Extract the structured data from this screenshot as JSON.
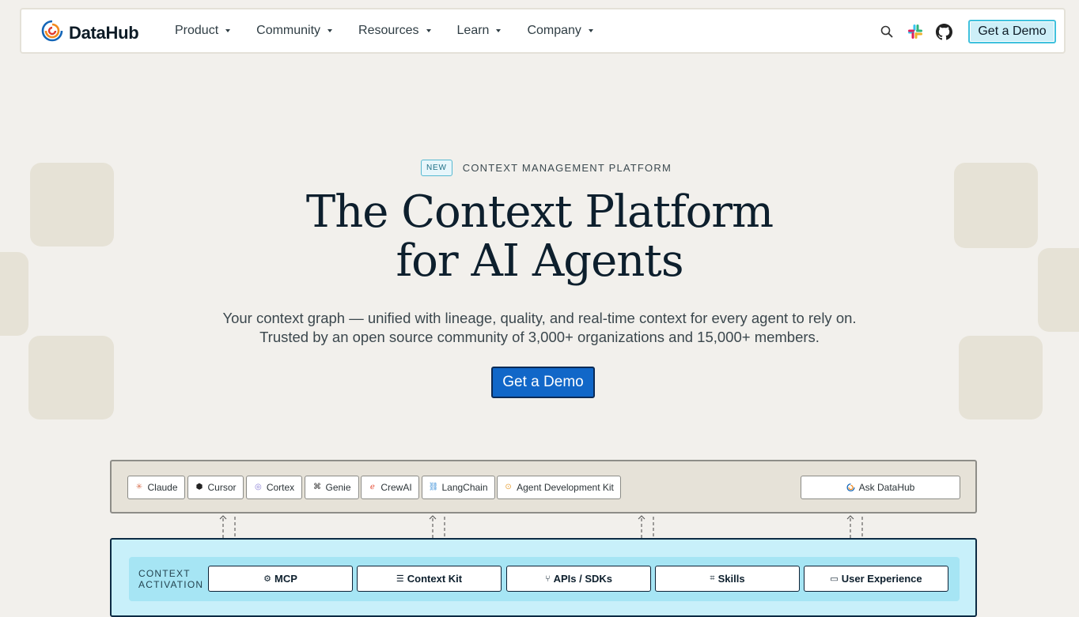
{
  "nav": {
    "logo_text": "DataHub",
    "menu": [
      {
        "label": "Product"
      },
      {
        "label": "Community"
      },
      {
        "label": "Resources"
      },
      {
        "label": "Learn"
      },
      {
        "label": "Company"
      }
    ],
    "icons": [
      "search-icon",
      "slack-icon",
      "github-icon"
    ],
    "cta_label": "Get a Demo"
  },
  "hero": {
    "badge": "NEW",
    "eyebrow": "CONTEXT MANAGEMENT PLATFORM",
    "title_line1": "The Context Platform",
    "title_line2": "for AI Agents",
    "subtitle_line1": "Your context graph — unified with lineage, quality, and real-time context for every agent to rely on.",
    "subtitle_line2": "Trusted by an open source community of 3,000+ organizations and 15,000+ members.",
    "cta_label": "Get a Demo"
  },
  "diagram": {
    "agents": [
      {
        "label": "Claude",
        "icon": "claude-icon",
        "color": "#d97757"
      },
      {
        "label": "Cursor",
        "icon": "cursor-icon",
        "color": "#222222"
      },
      {
        "label": "Cortex",
        "icon": "cortex-icon",
        "color": "#8a7fd6"
      },
      {
        "label": "Genie",
        "icon": "genie-icon",
        "color": "#333333"
      },
      {
        "label": "CrewAI",
        "icon": "crewai-icon",
        "color": "#e5533d"
      },
      {
        "label": "LangChain",
        "icon": "langchain-icon",
        "color": "#3a8fd8"
      },
      {
        "label": "Agent Development Kit",
        "icon": "adk-icon",
        "color": "#e8a23a"
      }
    ],
    "ask_label": "Ask DataHub",
    "activation_label_line1": "CONTEXT",
    "activation_label_line2": "ACTIVATION",
    "activation_items": [
      {
        "label": "MCP",
        "icon": "mcp-icon"
      },
      {
        "label": "Context Kit",
        "icon": "context-kit-icon"
      },
      {
        "label": "APIs / SDKs",
        "icon": "api-icon"
      },
      {
        "label": "Skills",
        "icon": "skills-icon"
      },
      {
        "label": "User Experience",
        "icon": "user-experience-icon"
      }
    ]
  },
  "colors": {
    "background": "#f2f0ec",
    "accent_blue": "#1167c8",
    "nav_demo_bg": "#cdeff8",
    "activation_bg": "#c8f0fa"
  }
}
